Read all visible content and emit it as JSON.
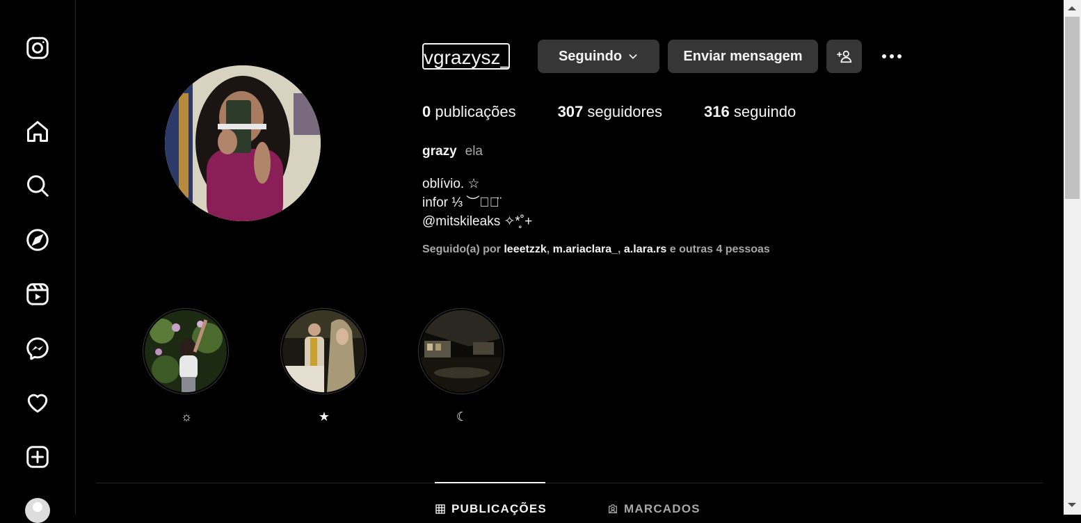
{
  "nav": {
    "items": [
      "instagram-logo",
      "home-icon",
      "search-icon",
      "explore-icon",
      "reels-icon",
      "messenger-icon",
      "heart-icon",
      "create-icon",
      "profile-avatar"
    ]
  },
  "profile": {
    "username": "vgrazysz_",
    "follow_button": "Seguindo",
    "message_button": "Enviar mensagem",
    "stats": {
      "posts_count": "0",
      "posts_label": "publicações",
      "followers_count": "307",
      "followers_label": "seguidores",
      "following_count": "316",
      "following_label": "seguindo"
    },
    "full_name": "grazy",
    "pronouns": "ela",
    "bio_lines": [
      "oblívio. ☆",
      "infor ⅓ ︶◡⃘̈",
      "@mitskileaks ✧*̥˚+"
    ],
    "followed_by": {
      "prefix": "Seguido(a) por",
      "users": [
        "leeetzzk",
        "m.ariaclara_",
        "a.lara.rs"
      ],
      "suffix": "e outras 4 pessoas"
    }
  },
  "highlights": [
    {
      "label": "☼"
    },
    {
      "label": "★"
    },
    {
      "label": "☾"
    }
  ],
  "tabs": [
    {
      "label": "PUBLICAÇÕES",
      "active": true
    },
    {
      "label": "MARCADOS",
      "active": false
    }
  ]
}
